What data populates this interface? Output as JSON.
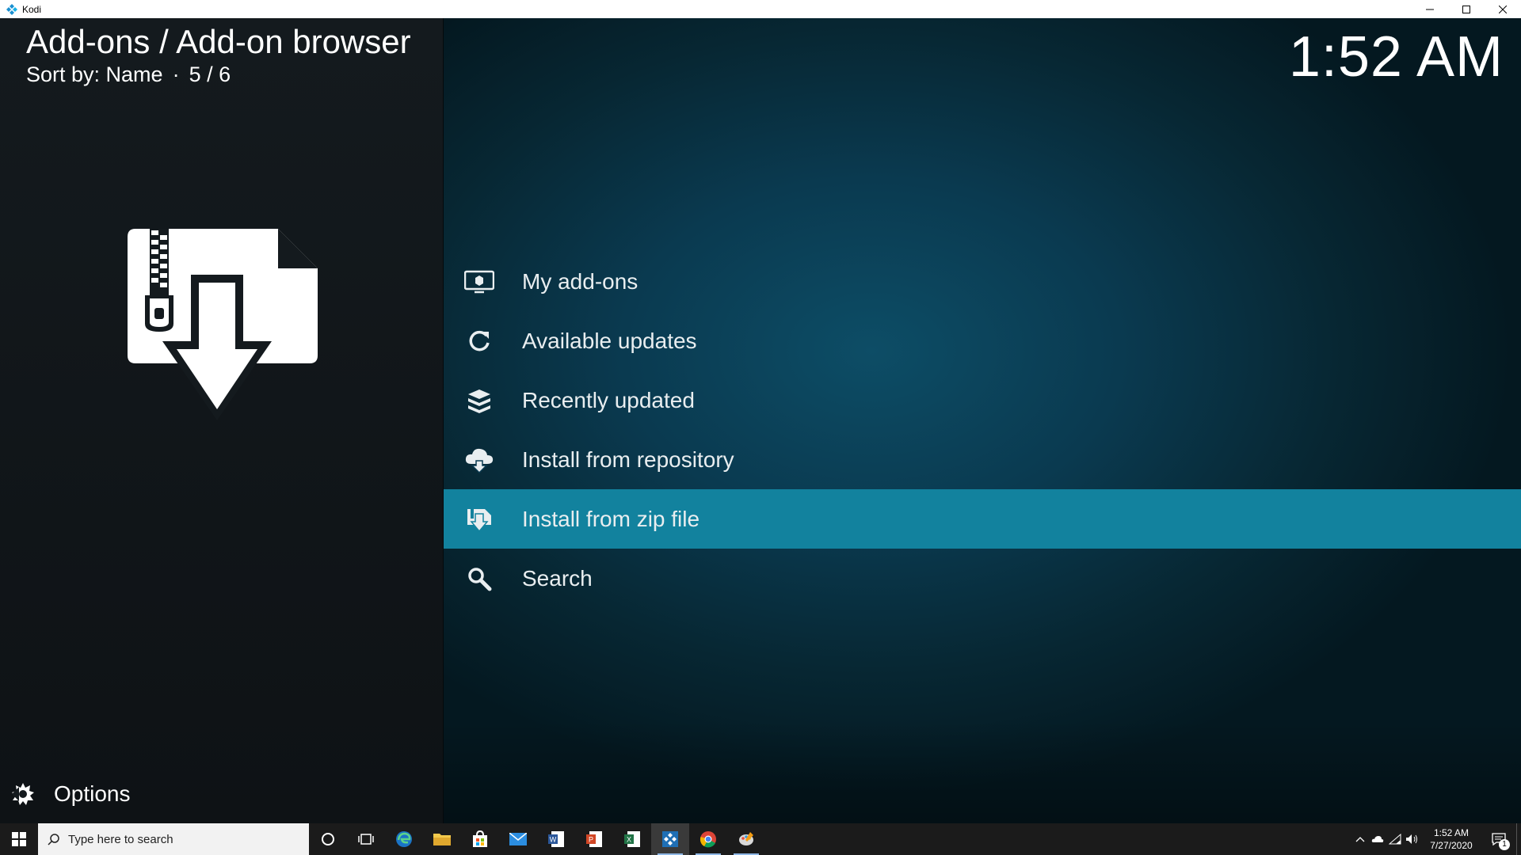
{
  "window": {
    "title": "Kodi"
  },
  "header": {
    "title": "Add-ons / Add-on browser",
    "sort_label": "Sort by: Name",
    "separator": "·",
    "position": "5 / 6"
  },
  "clock": "1:52 AM",
  "menu": {
    "items": [
      {
        "label": "My add-ons",
        "icon": "monitor-box-icon"
      },
      {
        "label": "Available updates",
        "icon": "refresh-icon"
      },
      {
        "label": "Recently updated",
        "icon": "stack-boxes-icon"
      },
      {
        "label": "Install from repository",
        "icon": "cloud-download-icon"
      },
      {
        "label": "Install from zip file",
        "icon": "zip-download-icon",
        "focused": true
      },
      {
        "label": "Search",
        "icon": "search-icon"
      }
    ]
  },
  "options": {
    "label": "Options"
  },
  "taskbar": {
    "search_placeholder": "Type here to search",
    "time": "1:52 AM",
    "date": "7/27/2020",
    "notification_count": "1"
  },
  "colors": {
    "focus": "#12829e",
    "background": "#0a3a50",
    "panel": "#12181c"
  }
}
